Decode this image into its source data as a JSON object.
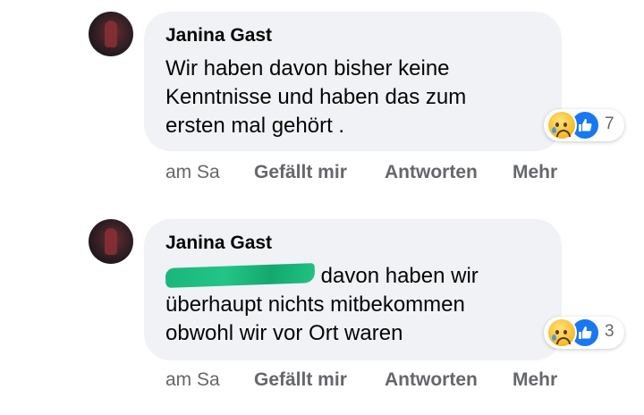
{
  "comments": [
    {
      "author": "Janina Gast",
      "text": "Wir haben davon bisher keine\nKenntnisse und haben das zum\nersten mal gehört .",
      "reaction_count": "7",
      "time": "am Sa",
      "like_label": "Gefällt mir",
      "reply_label": "Antworten",
      "more_label": "Mehr"
    },
    {
      "author": "Janina Gast",
      "text_line1": " davon haben wir",
      "text_rest": "überhaupt nichts mitbekommen\nobwohl wir vor Ort waren",
      "reaction_count": "3",
      "time": "am Sa",
      "like_label": "Gefällt mir",
      "reply_label": "Antworten",
      "more_label": "Mehr"
    }
  ],
  "reaction_icons": [
    "sad-icon",
    "like-icon"
  ],
  "colors": {
    "bubble": "#f0f2f5",
    "like_blue": "#1877f2",
    "secondary_text": "#65676b",
    "redaction": "#1fc283"
  }
}
